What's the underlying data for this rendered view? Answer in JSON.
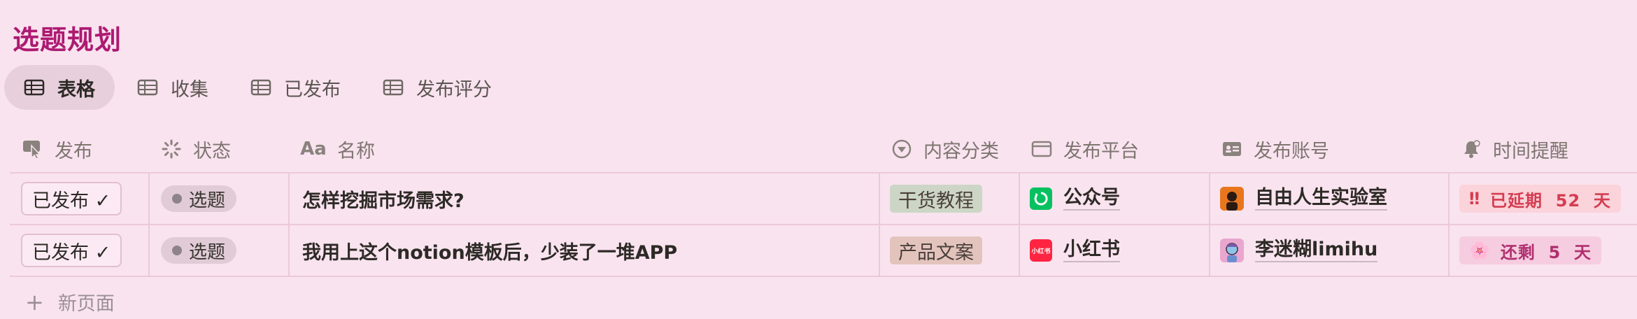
{
  "page_title": "选题规划",
  "views": [
    {
      "label": "表格",
      "active": true
    },
    {
      "label": "收集",
      "active": false
    },
    {
      "label": "已发布",
      "active": false
    },
    {
      "label": "发布评分",
      "active": false
    }
  ],
  "columns": {
    "publish": "发布",
    "status": "状态",
    "name": "名称",
    "category": "内容分类",
    "platform": "发布平台",
    "account": "发布账号",
    "reminder": "时间提醒"
  },
  "rows": [
    {
      "publish": "已发布 ✓",
      "status": "选题",
      "name": "怎样挖掘市场需求?",
      "category": "干货教程",
      "platform": "公众号",
      "account": "自由人生实验室",
      "reminder_icon": "‼",
      "reminder": "已延期  52  天"
    },
    {
      "publish": "已发布 ✓",
      "status": "选题",
      "name": "我用上这个notion模板后，少装了一堆APP",
      "category": "产品文案",
      "platform": "小红书",
      "platform_icon_text": "小红书",
      "account": "李迷糊limihu",
      "reminder_icon": "🌸",
      "reminder": "还剩  5  天"
    }
  ],
  "new_page": "新页面",
  "colors": {
    "title": "#ad1a72",
    "background": "#f9e3ef",
    "wechat_green": "#07c160",
    "xiaohongshu_red": "#ff2442"
  },
  "icons": {
    "view": "table-icon",
    "publish": "cursor-click-icon",
    "status": "loading-icon",
    "name": "text-aa-icon",
    "category": "select-icon",
    "platform": "window-icon",
    "account": "contact-card-icon",
    "reminder": "bell-icon"
  }
}
